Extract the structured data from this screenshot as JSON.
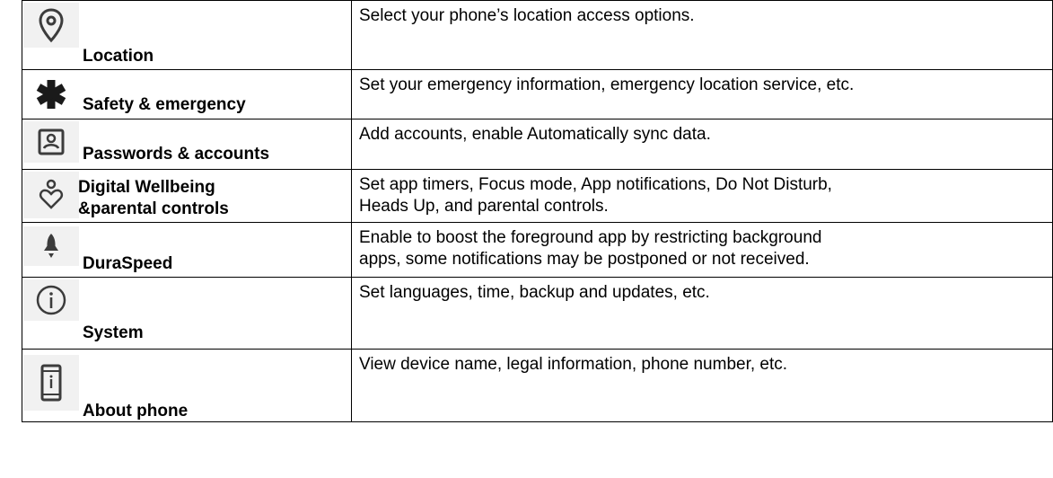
{
  "rows": [
    {
      "label": "Location",
      "label_line2": "",
      "description": "Select your phone’s location access options.",
      "description_line2": "",
      "icon": "location-pin-icon"
    },
    {
      "label": "Safety & emergency",
      "label_line2": "",
      "description": "Set your emergency information, emergency location service, etc.",
      "description_line2": "",
      "icon": "asterisk-icon"
    },
    {
      "label": "Passwords & accounts",
      "label_line2": "",
      "description": "Add accounts, enable Automatically sync data.",
      "description_line2": "",
      "icon": "account-box-icon"
    },
    {
      "label": "Digital Wellbeing",
      "label_line2": "&parental controls",
      "description": "Set app timers, Focus mode, App notifications, Do Not Disturb,",
      "description_line2": "Heads Up, and parental controls.",
      "icon": "wellbeing-heart-icon"
    },
    {
      "label": "DuraSpeed",
      "label_line2": "",
      "description": "Enable to boost the foreground app by restricting background",
      "description_line2": "apps, some notifications may be postponed or not received.",
      "icon": "rocket-icon"
    },
    {
      "label": "System",
      "label_line2": "",
      "description": "Set languages, time, backup and updates, etc.",
      "description_line2": "",
      "icon": "info-circle-icon"
    },
    {
      "label": "About phone",
      "label_line2": "",
      "description": "View device name, legal information, phone number, etc.",
      "description_line2": "",
      "icon": "phone-info-icon"
    }
  ],
  "colors": {
    "icon_bg": "#f1f1f1",
    "icon_fg": "#3c3c3c",
    "border": "#000000"
  }
}
